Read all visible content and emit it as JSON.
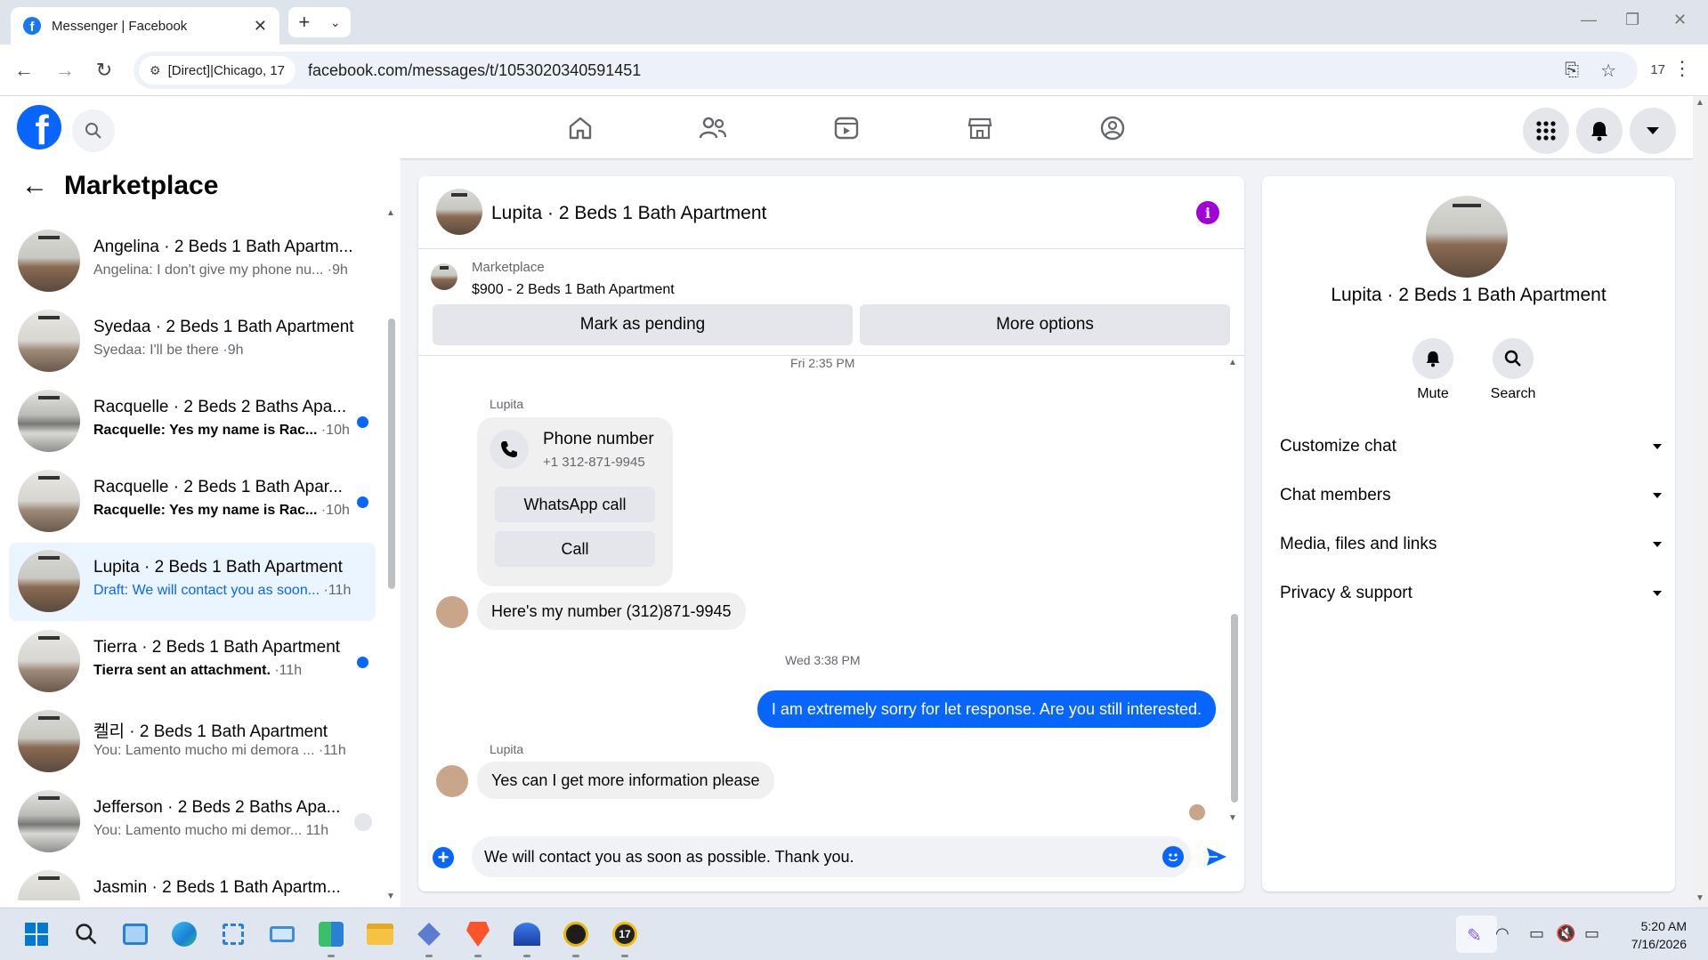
{
  "browser": {
    "tab_title": "Messenger | Facebook",
    "site_info": "[Direct]|Chicago, 17",
    "url": "facebook.com/messages/t/1053020340591451",
    "extension_count": "17"
  },
  "sidebar": {
    "title": "Marketplace",
    "conversations": [
      {
        "name": "Angelina · 2 Beds 1 Bath Apartm...",
        "preview": "Angelina: I don't give my phone nu...",
        "time": "·9h",
        "unread": false,
        "active": false
      },
      {
        "name": "Syedaa · 2 Beds 1 Bath Apartment",
        "preview": "Syedaa: I'll be there",
        "time": "·9h",
        "unread": false,
        "active": false
      },
      {
        "name": "Racquelle · 2 Beds 2 Baths Apa...",
        "preview": "Racquelle: Yes my name is Rac...",
        "time": "·10h",
        "unread": true,
        "active": false
      },
      {
        "name": "Racquelle · 2 Beds 1 Bath Apar...",
        "preview": "Racquelle: Yes my name is Rac...",
        "time": "·10h",
        "unread": true,
        "active": false
      },
      {
        "name": "Lupita · 2 Beds 1 Bath Apartment",
        "draft_label": "Draft:",
        "preview": "We will contact you as soon...",
        "time": "·11h",
        "unread": false,
        "active": true
      },
      {
        "name": "Tierra · 2 Beds 1 Bath Apartment",
        "preview": "Tierra sent an attachment.",
        "time": "·11h",
        "unread": true,
        "active": false
      },
      {
        "name": "켈리 · 2 Beds 1 Bath Apartment",
        "preview": "You: Lamento mucho mi demora ...",
        "time": "·11h",
        "unread": false,
        "active": false
      },
      {
        "name": "Jefferson · 2 Beds 2 Baths Apa...",
        "preview": "You: Lamento mucho mi demor...",
        "time": "11h",
        "unread": false,
        "active": false
      },
      {
        "name": "Jasmin · 2 Beds 1 Bath Apartm...",
        "preview": "",
        "time": "",
        "unread": true,
        "active": false
      }
    ]
  },
  "chat": {
    "title": "Lupita · 2 Beds 1 Bath Apartment",
    "marketplace_label": "Marketplace",
    "listing": "$900 - 2 Beds 1 Bath Apartment",
    "mark_pending": "Mark as pending",
    "more_options": "More options",
    "timestamp1": "Fri 2:35 PM",
    "sender1": "Lupita",
    "phone_card": {
      "title": "Phone number",
      "number": "+1 312-871-9945",
      "whatsapp": "WhatsApp call",
      "call": "Call"
    },
    "msg1": "Here's my number (312)871-9945",
    "timestamp2": "Wed 3:38 PM",
    "msg2": "I am extremely sorry for let response. Are you still interested.",
    "sender2": "Lupita",
    "msg3": "Yes can I get more information please",
    "composer_value": "We will contact you as soon as possible. Thank you."
  },
  "info_panel": {
    "name": "Lupita · 2 Beds 1 Bath Apartment",
    "mute": "Mute",
    "search": "Search",
    "sections": [
      "Customize chat",
      "Chat members",
      "Media, files and links",
      "Privacy & support"
    ]
  },
  "taskbar": {
    "time": "5:20 AM",
    "date": "7/16/2026",
    "apps": [
      "windows-start",
      "search",
      "photos",
      "edge",
      "snipping-tool",
      "remote-desktop",
      "store-grid",
      "file-explorer",
      "network-tool",
      "brave",
      "vpn",
      "xbox-bar",
      "calendar-17"
    ]
  },
  "colors": {
    "brand_blue": "#0866ff",
    "info_purple": "#a100d6",
    "active_conv_bg": "#ebf5ff"
  }
}
